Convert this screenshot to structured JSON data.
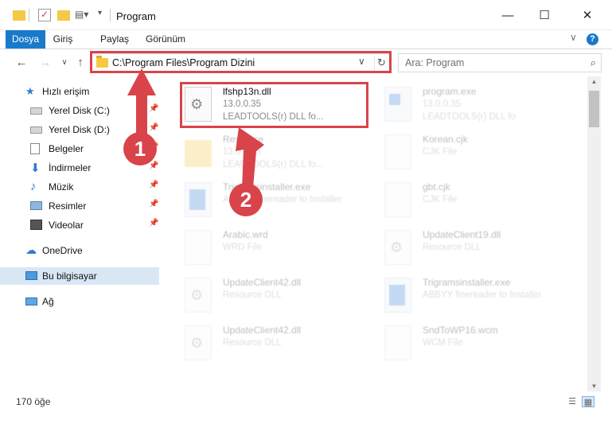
{
  "window": {
    "title": "Program",
    "min_glyph": "—",
    "max_glyph": "☐",
    "close_glyph": "✕"
  },
  "ribbon": {
    "tabs": [
      {
        "label": "Dosya",
        "active": true
      },
      {
        "label": "Giriş",
        "active": false
      },
      {
        "label": "Paylaş",
        "active": false
      },
      {
        "label": "Görünüm",
        "active": false
      }
    ],
    "expand_glyph": "∨",
    "help_glyph": "?"
  },
  "nav": {
    "back_glyph": "←",
    "forward_glyph": "→",
    "recent_glyph": "∨",
    "up_glyph": "↑"
  },
  "address": {
    "path": "C:\\Program Files\\Program Dizini",
    "dropdown_glyph": "∨",
    "refresh_glyph": "↻"
  },
  "search": {
    "placeholder": "Ara: Program",
    "icon_glyph": "⌕"
  },
  "sidebar": {
    "quick_access": {
      "label": "Hızlı erişim"
    },
    "items": [
      {
        "label": "Yerel Disk (C:)",
        "pinned": true
      },
      {
        "label": "Yerel Disk (D:)",
        "pinned": true
      },
      {
        "label": "Belgeler",
        "pinned": true
      },
      {
        "label": "İndirmeler",
        "pinned": true
      },
      {
        "label": "Müzik",
        "pinned": true
      },
      {
        "label": "Resimler",
        "pinned": true
      },
      {
        "label": "Videolar",
        "pinned": true
      }
    ],
    "onedrive": {
      "label": "OneDrive"
    },
    "this_pc": {
      "label": "Bu bilgisayar",
      "selected": true
    },
    "network": {
      "label": "Ağ"
    },
    "pin_glyph": "📌"
  },
  "files": [
    {
      "name": "lfshp13n.dll",
      "line1": "13.0.0.35",
      "line2": "LEADTOOLS(r) DLL fo...",
      "icon": "gear-file-icon",
      "highlighted": true
    },
    {
      "name": "program.exe",
      "line1": "13.0.0.35",
      "line2": "LEADTOOLS(r) DLL fo",
      "icon": "app-icon",
      "highlighted": false
    },
    {
      "name": "Resource",
      "line1": "13.0.0.35",
      "line2": "LEADTOOLS(r) DLL fo...",
      "icon": "folder-icon",
      "highlighted": false
    },
    {
      "name": "Korean.cjk",
      "line1": "CJK File",
      "line2": "",
      "icon": "blank-file-icon",
      "highlighted": false
    },
    {
      "name": "Trigramsinstaller.exe",
      "line1": "ABBYY finereader to Installer",
      "line2": "",
      "icon": "installer-icon",
      "highlighted": false
    },
    {
      "name": "gbt.cjk",
      "line1": "CJK File",
      "line2": "",
      "icon": "blank-file-icon",
      "highlighted": false
    },
    {
      "name": "Arabic.wrd",
      "line1": "WRD File",
      "line2": "",
      "icon": "blank-file-icon",
      "highlighted": false
    },
    {
      "name": "UpdateClient19.dll",
      "line1": "Resource DLL",
      "line2": "",
      "icon": "gear-file-icon",
      "highlighted": false
    },
    {
      "name": "UpdateClient42.dll",
      "line1": "Resource DLL",
      "line2": "",
      "icon": "gear-file-icon",
      "highlighted": false
    },
    {
      "name": "Trigramsinstaller.exe",
      "line1": "ABBYY finereader to Installer",
      "line2": "",
      "icon": "installer-icon",
      "highlighted": false
    },
    {
      "name": "UpdateClient42.dll",
      "line1": "Resource DLL",
      "line2": "",
      "icon": "gear-file-icon",
      "highlighted": false
    },
    {
      "name": "SndToWP16.wcm",
      "line1": "WCM File",
      "line2": "",
      "icon": "blank-file-icon",
      "highlighted": false
    }
  ],
  "status": {
    "item_count": "170 öğe"
  },
  "annotations": {
    "step1": "1",
    "step2": "2",
    "color": "#d9434a"
  },
  "colors": {
    "accent": "#1979ca",
    "selection": "#d9e7f5",
    "highlight": "#d9434a"
  }
}
